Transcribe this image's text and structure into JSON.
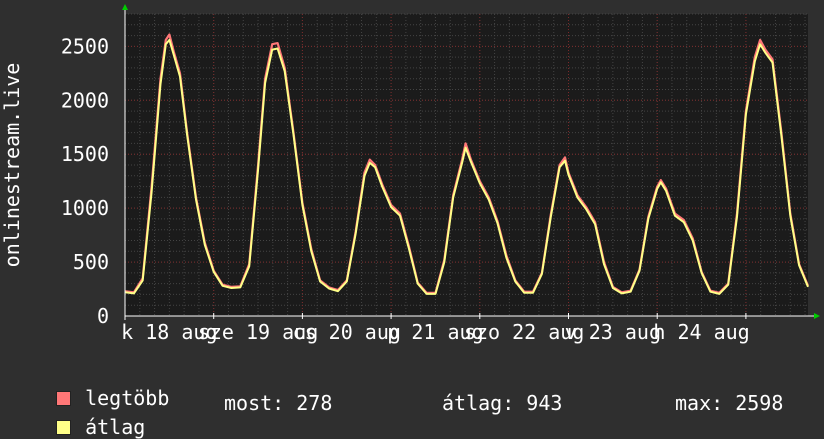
{
  "colors": {
    "background": "#2f2f2f",
    "plot_background": "#1b1b1b",
    "grid_major": "#7a2a2a",
    "grid_minor": "#444444",
    "axis": "#ffffff",
    "max_series": "#ff7777",
    "avg_series": "#ffff88",
    "arrow": "#00cc00"
  },
  "legend": {
    "max_label": "legtöbb",
    "avg_label": "átlag"
  },
  "stats": {
    "now": "most: 278",
    "average": "átlag: 943",
    "max": "max: 2598"
  },
  "chart_data": {
    "type": "line",
    "ylabel": "onlinestream.live",
    "ylim": [
      0,
      2800
    ],
    "xlim": [
      0,
      7.7
    ],
    "yticks": [
      0,
      500,
      1000,
      1500,
      2000,
      2500
    ],
    "xtick_labels": [
      "k 18 aug",
      "sze 19 aug",
      "cs 20 aug",
      "p 21 aug",
      "szo 22 aug",
      "v 23 aug",
      "h 24 aug"
    ],
    "grid": true,
    "series": [
      {
        "name": "legtöbb",
        "points": [
          [
            0.0,
            230
          ],
          [
            0.1,
            220
          ],
          [
            0.2,
            350
          ],
          [
            0.3,
            1200
          ],
          [
            0.4,
            2200
          ],
          [
            0.46,
            2560
          ],
          [
            0.5,
            2610
          ],
          [
            0.55,
            2450
          ],
          [
            0.62,
            2250
          ],
          [
            0.7,
            1700
          ],
          [
            0.8,
            1100
          ],
          [
            0.9,
            680
          ],
          [
            1.0,
            420
          ],
          [
            1.1,
            290
          ],
          [
            1.2,
            270
          ],
          [
            1.3,
            275
          ],
          [
            1.4,
            480
          ],
          [
            1.5,
            1400
          ],
          [
            1.58,
            2200
          ],
          [
            1.66,
            2520
          ],
          [
            1.72,
            2530
          ],
          [
            1.8,
            2300
          ],
          [
            1.9,
            1700
          ],
          [
            2.0,
            1050
          ],
          [
            2.1,
            620
          ],
          [
            2.2,
            330
          ],
          [
            2.3,
            265
          ],
          [
            2.4,
            240
          ],
          [
            2.5,
            330
          ],
          [
            2.6,
            780
          ],
          [
            2.7,
            1330
          ],
          [
            2.76,
            1450
          ],
          [
            2.82,
            1400
          ],
          [
            2.9,
            1220
          ],
          [
            3.0,
            1030
          ],
          [
            3.1,
            950
          ],
          [
            3.2,
            650
          ],
          [
            3.3,
            310
          ],
          [
            3.4,
            215
          ],
          [
            3.5,
            215
          ],
          [
            3.6,
            520
          ],
          [
            3.7,
            1120
          ],
          [
            3.8,
            1450
          ],
          [
            3.84,
            1600
          ],
          [
            3.9,
            1450
          ],
          [
            4.0,
            1250
          ],
          [
            4.1,
            1100
          ],
          [
            4.2,
            880
          ],
          [
            4.3,
            560
          ],
          [
            4.4,
            330
          ],
          [
            4.5,
            225
          ],
          [
            4.6,
            225
          ],
          [
            4.7,
            400
          ],
          [
            4.8,
            940
          ],
          [
            4.9,
            1400
          ],
          [
            4.96,
            1470
          ],
          [
            5.0,
            1330
          ],
          [
            5.1,
            1120
          ],
          [
            5.2,
            1010
          ],
          [
            5.3,
            870
          ],
          [
            5.4,
            500
          ],
          [
            5.5,
            270
          ],
          [
            5.6,
            220
          ],
          [
            5.7,
            235
          ],
          [
            5.8,
            430
          ],
          [
            5.9,
            920
          ],
          [
            6.0,
            1200
          ],
          [
            6.04,
            1260
          ],
          [
            6.1,
            1180
          ],
          [
            6.2,
            950
          ],
          [
            6.3,
            890
          ],
          [
            6.4,
            720
          ],
          [
            6.5,
            410
          ],
          [
            6.6,
            235
          ],
          [
            6.7,
            215
          ],
          [
            6.8,
            300
          ],
          [
            6.9,
            950
          ],
          [
            7.0,
            1900
          ],
          [
            7.1,
            2400
          ],
          [
            7.16,
            2560
          ],
          [
            7.22,
            2470
          ],
          [
            7.3,
            2380
          ],
          [
            7.4,
            1700
          ],
          [
            7.5,
            950
          ],
          [
            7.6,
            480
          ],
          [
            7.7,
            280
          ]
        ]
      },
      {
        "name": "átlag",
        "points": [
          [
            0.0,
            220
          ],
          [
            0.1,
            210
          ],
          [
            0.2,
            330
          ],
          [
            0.3,
            1150
          ],
          [
            0.4,
            2150
          ],
          [
            0.46,
            2520
          ],
          [
            0.5,
            2560
          ],
          [
            0.55,
            2420
          ],
          [
            0.62,
            2220
          ],
          [
            0.7,
            1680
          ],
          [
            0.8,
            1080
          ],
          [
            0.9,
            660
          ],
          [
            1.0,
            410
          ],
          [
            1.1,
            280
          ],
          [
            1.2,
            260
          ],
          [
            1.3,
            265
          ],
          [
            1.4,
            460
          ],
          [
            1.5,
            1360
          ],
          [
            1.58,
            2160
          ],
          [
            1.66,
            2470
          ],
          [
            1.72,
            2480
          ],
          [
            1.8,
            2270
          ],
          [
            1.9,
            1680
          ],
          [
            2.0,
            1030
          ],
          [
            2.1,
            600
          ],
          [
            2.2,
            320
          ],
          [
            2.3,
            255
          ],
          [
            2.4,
            230
          ],
          [
            2.5,
            320
          ],
          [
            2.6,
            760
          ],
          [
            2.7,
            1300
          ],
          [
            2.76,
            1420
          ],
          [
            2.82,
            1380
          ],
          [
            2.9,
            1200
          ],
          [
            3.0,
            1010
          ],
          [
            3.1,
            930
          ],
          [
            3.2,
            630
          ],
          [
            3.3,
            300
          ],
          [
            3.4,
            205
          ],
          [
            3.5,
            205
          ],
          [
            3.6,
            500
          ],
          [
            3.7,
            1100
          ],
          [
            3.8,
            1420
          ],
          [
            3.84,
            1560
          ],
          [
            3.9,
            1430
          ],
          [
            4.0,
            1230
          ],
          [
            4.1,
            1080
          ],
          [
            4.2,
            860
          ],
          [
            4.3,
            540
          ],
          [
            4.4,
            320
          ],
          [
            4.5,
            215
          ],
          [
            4.6,
            215
          ],
          [
            4.7,
            390
          ],
          [
            4.8,
            920
          ],
          [
            4.9,
            1380
          ],
          [
            4.96,
            1440
          ],
          [
            5.0,
            1310
          ],
          [
            5.1,
            1100
          ],
          [
            5.2,
            990
          ],
          [
            5.3,
            850
          ],
          [
            5.4,
            480
          ],
          [
            5.5,
            260
          ],
          [
            5.6,
            210
          ],
          [
            5.7,
            225
          ],
          [
            5.8,
            420
          ],
          [
            5.9,
            900
          ],
          [
            6.0,
            1180
          ],
          [
            6.04,
            1240
          ],
          [
            6.1,
            1160
          ],
          [
            6.2,
            930
          ],
          [
            6.3,
            870
          ],
          [
            6.4,
            700
          ],
          [
            6.5,
            400
          ],
          [
            6.6,
            225
          ],
          [
            6.7,
            205
          ],
          [
            6.8,
            290
          ],
          [
            6.9,
            920
          ],
          [
            7.0,
            1870
          ],
          [
            7.1,
            2360
          ],
          [
            7.16,
            2520
          ],
          [
            7.22,
            2440
          ],
          [
            7.3,
            2350
          ],
          [
            7.4,
            1670
          ],
          [
            7.5,
            930
          ],
          [
            7.6,
            470
          ],
          [
            7.7,
            270
          ]
        ]
      }
    ]
  }
}
